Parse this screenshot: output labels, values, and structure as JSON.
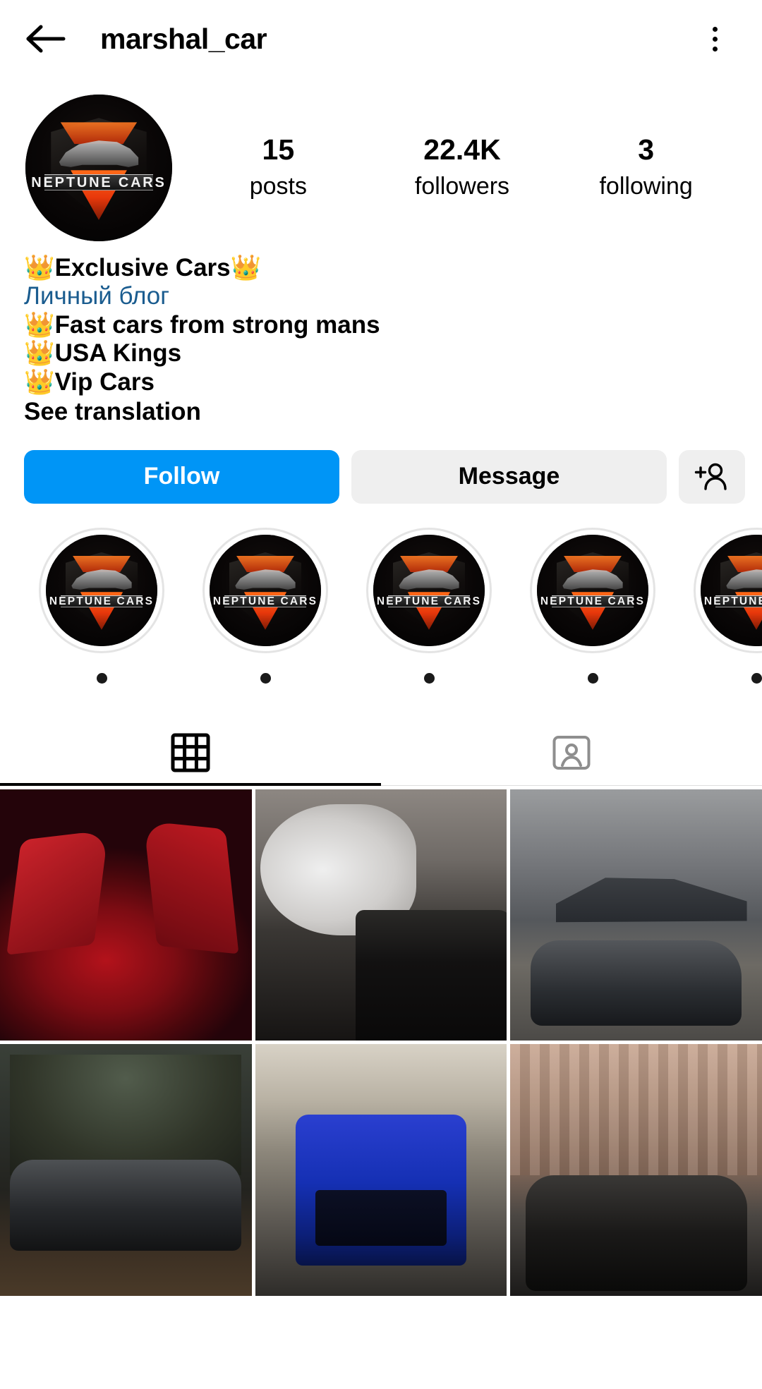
{
  "header": {
    "back_icon": "back-arrow-icon",
    "title": "marshal_car",
    "menu_icon": "kebab-menu-icon"
  },
  "profile": {
    "avatar_logo_text": "NEPTUNE CARS",
    "stats": [
      {
        "value": "15",
        "label": "posts"
      },
      {
        "value": "22.4K",
        "label": "followers"
      },
      {
        "value": "3",
        "label": "following"
      }
    ]
  },
  "bio": {
    "lines": [
      "👑Exclusive Cars👑",
      "👑Fast cars from strong mans",
      "👑USA Kings",
      "👑Vip Cars"
    ],
    "category": "Личный блог",
    "see_translation": "See translation"
  },
  "actions": {
    "follow_label": "Follow",
    "message_label": "Message",
    "add_person_icon": "add-person-icon",
    "follow_color": "#0095f6",
    "secondary_color": "#efefef"
  },
  "highlights": {
    "cover_label": "NEPTUNE CARS",
    "items": [
      {
        "cover_text": "NEPTUNE CARS"
      },
      {
        "cover_text": "NEPTUNE CARS"
      },
      {
        "cover_text": "NEPTUNE CARS"
      },
      {
        "cover_text": "NEPTUNE CARS"
      },
      {
        "cover_text": "NEPTUNE CARS"
      }
    ]
  },
  "tabs": [
    {
      "name": "grid-tab",
      "icon": "grid-icon",
      "active": true
    },
    {
      "name": "tagged-tab",
      "icon": "tagged-person-icon",
      "active": false
    }
  ],
  "grid": {
    "posts": [
      {
        "alt": "red-supercar-doors-open"
      },
      {
        "alt": "black-rolls-royce-private-jet"
      },
      {
        "alt": "bugatti-chiron-fighter-jet"
      },
      {
        "alt": "black-audi-r8-forest"
      },
      {
        "alt": "blue-mercedes-g-class-showroom"
      },
      {
        "alt": "black-mercedes-amg-gt-brick-wall"
      }
    ]
  }
}
